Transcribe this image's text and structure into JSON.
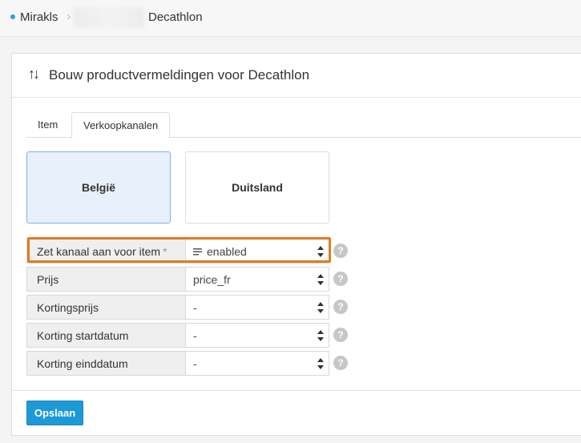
{
  "breadcrumb": {
    "root": "Mirakls",
    "current": "Decathlon"
  },
  "panel": {
    "title": "Bouw productvermeldingen voor Decathlon",
    "title_icon": "sort-arrows-icon"
  },
  "tabs": [
    {
      "label": "Item",
      "active": false
    },
    {
      "label": "Verkoopkanalen",
      "active": true
    }
  ],
  "channels": [
    {
      "label": "België",
      "selected": true
    },
    {
      "label": "Duitsland",
      "selected": false
    }
  ],
  "fields": [
    {
      "label": "Zet kanaal aan voor item",
      "required_mark": "*",
      "value": "enabled",
      "icon": "text-lines-icon",
      "highlighted": true
    },
    {
      "label": "Prijs",
      "value": "price_fr"
    },
    {
      "label": "Kortingsprijs",
      "value": "-"
    },
    {
      "label": "Korting startdatum",
      "value": "-"
    },
    {
      "label": "Korting einddatum",
      "value": "-"
    }
  ],
  "help_glyph": "?",
  "footer": {
    "save_label": "Opslaan"
  },
  "colors": {
    "accent": "#1d9ad6",
    "highlight": "#e07b22",
    "selected_card": "#e8f0fc"
  }
}
